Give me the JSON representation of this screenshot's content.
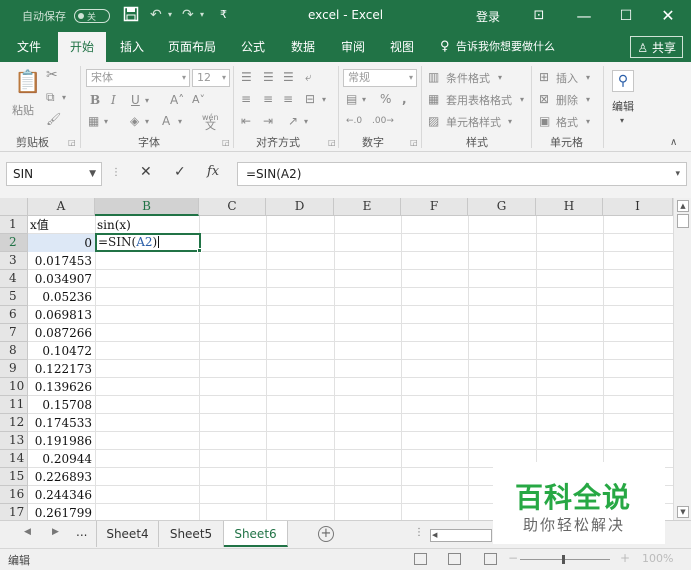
{
  "titlebar": {
    "autosave": "自动保存",
    "autosave_state": "关",
    "title": "excel  -  Excel",
    "login": "登录",
    "qat_more": "₹"
  },
  "ribbon_tabs": [
    {
      "label": "文件",
      "active": false
    },
    {
      "label": "开始",
      "active": true
    },
    {
      "label": "插入",
      "active": false
    },
    {
      "label": "页面布局",
      "active": false
    },
    {
      "label": "公式",
      "active": false
    },
    {
      "label": "数据",
      "active": false
    },
    {
      "label": "审阅",
      "active": false
    },
    {
      "label": "视图",
      "active": false
    }
  ],
  "tell_me": "告诉我你想要做什么",
  "share": "共享",
  "ribbon": {
    "paste": "粘贴",
    "clipboard": "剪贴板",
    "font_name": "宋体",
    "font_size": "12",
    "font_group": "字体",
    "wen": "wén",
    "align_group": "对齐方式",
    "number_format": "常规",
    "number_group": "数字",
    "percent": "%",
    "cond_format": "条件格式",
    "table_format": "套用表格格式",
    "cell_style": "单元格样式",
    "styles_group": "样式",
    "insert": "插入",
    "delete": "删除",
    "format": "格式",
    "cells_group": "单元格",
    "edit": "编辑"
  },
  "formula_bar": {
    "name_box": "SIN",
    "fx": "fx",
    "formula": "=SIN(A2)"
  },
  "columns": [
    "A",
    "B",
    "C",
    "D",
    "E",
    "F",
    "G",
    "H",
    "I"
  ],
  "rows": [
    "1",
    "2",
    "3",
    "4",
    "5",
    "6",
    "7",
    "8",
    "9",
    "10",
    "11",
    "12",
    "13",
    "14",
    "15",
    "16",
    "17"
  ],
  "header_row": {
    "a": "x值",
    "b": "sin(x)"
  },
  "a_values": [
    "0",
    "0.017453",
    "0.034907",
    "0.05236",
    "0.069813",
    "0.087266",
    "0.10472",
    "0.122173",
    "0.139626",
    "0.15708",
    "0.174533",
    "0.191986",
    "0.20944",
    "0.226893",
    "0.244346",
    "0.261799"
  ],
  "editing": {
    "prefix": "=SIN(",
    "ref": "A2",
    "suffix": ")"
  },
  "sheets": [
    {
      "label": "Sheet4",
      "active": false
    },
    {
      "label": "Sheet5",
      "active": false
    },
    {
      "label": "Sheet6",
      "active": true
    }
  ],
  "sheet_nav_more": "...",
  "status": {
    "mode": "编辑",
    "zoom": "100%"
  },
  "watermark": {
    "line1": "百科全说",
    "line2": "助你轻松解决"
  }
}
